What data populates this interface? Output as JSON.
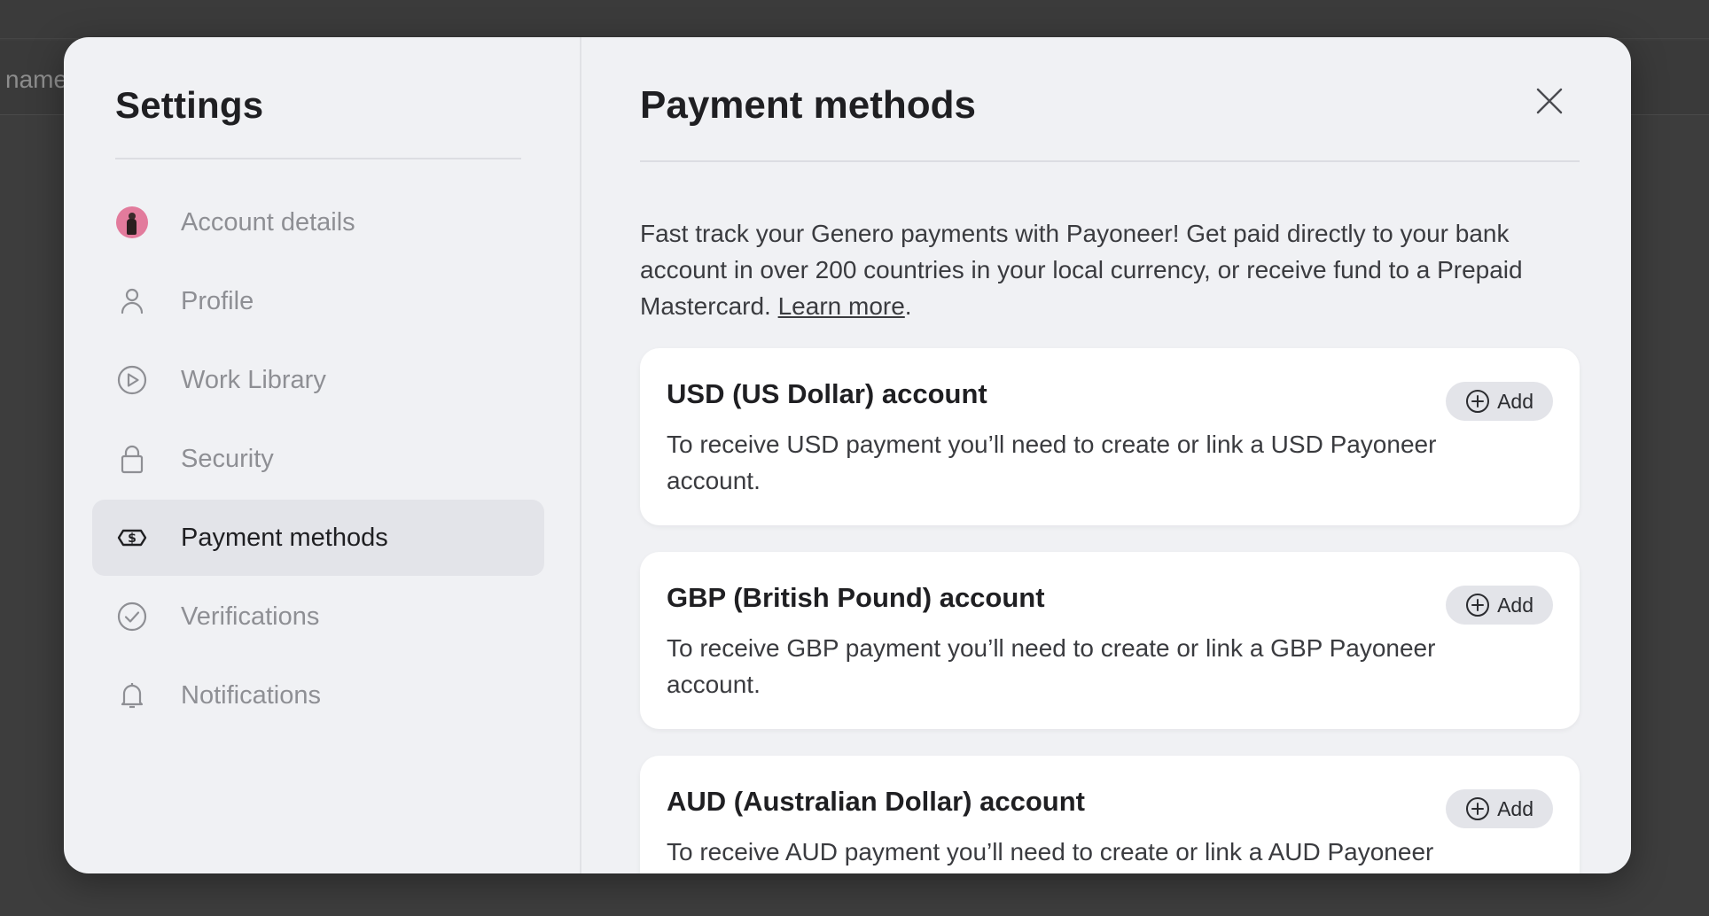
{
  "background": {
    "partial_text": "name"
  },
  "sidebar": {
    "title": "Settings",
    "items": [
      {
        "label": "Account details",
        "icon": "avatar",
        "active": false
      },
      {
        "label": "Profile",
        "icon": "user-icon",
        "active": false
      },
      {
        "label": "Work Library",
        "icon": "play-icon",
        "active": false
      },
      {
        "label": "Security",
        "icon": "lock-icon",
        "active": false
      },
      {
        "label": "Payment methods",
        "icon": "money-icon",
        "active": true
      },
      {
        "label": "Verifications",
        "icon": "check-circle-icon",
        "active": false
      },
      {
        "label": "Notifications",
        "icon": "bell-icon",
        "active": false
      }
    ]
  },
  "main": {
    "title": "Payment methods",
    "intro_text": "Fast track your Genero payments with Payoneer! Get paid directly to your bank account in over 200 countries in your local currency, or receive fund to a Prepaid Mastercard. ",
    "learn_more": "Learn more",
    "intro_end": ".",
    "cards": [
      {
        "title": "USD (US Dollar) account",
        "description": "To receive USD payment you’ll need to create or link a USD Payoneer account.",
        "button": "Add"
      },
      {
        "title": "GBP (British Pound) account",
        "description": "To receive GBP payment you’ll need to create or link a GBP Payoneer account.",
        "button": "Add"
      },
      {
        "title": "AUD (Australian Dollar) account",
        "description": "To receive AUD payment you’ll need to create or link a AUD Payoneer",
        "button": "Add"
      }
    ]
  },
  "colors": {
    "backdrop": "#3d3d3d",
    "modal_bg": "#f0f1f4",
    "active_item_bg": "#e3e4e9",
    "avatar": "#e27b9c"
  }
}
